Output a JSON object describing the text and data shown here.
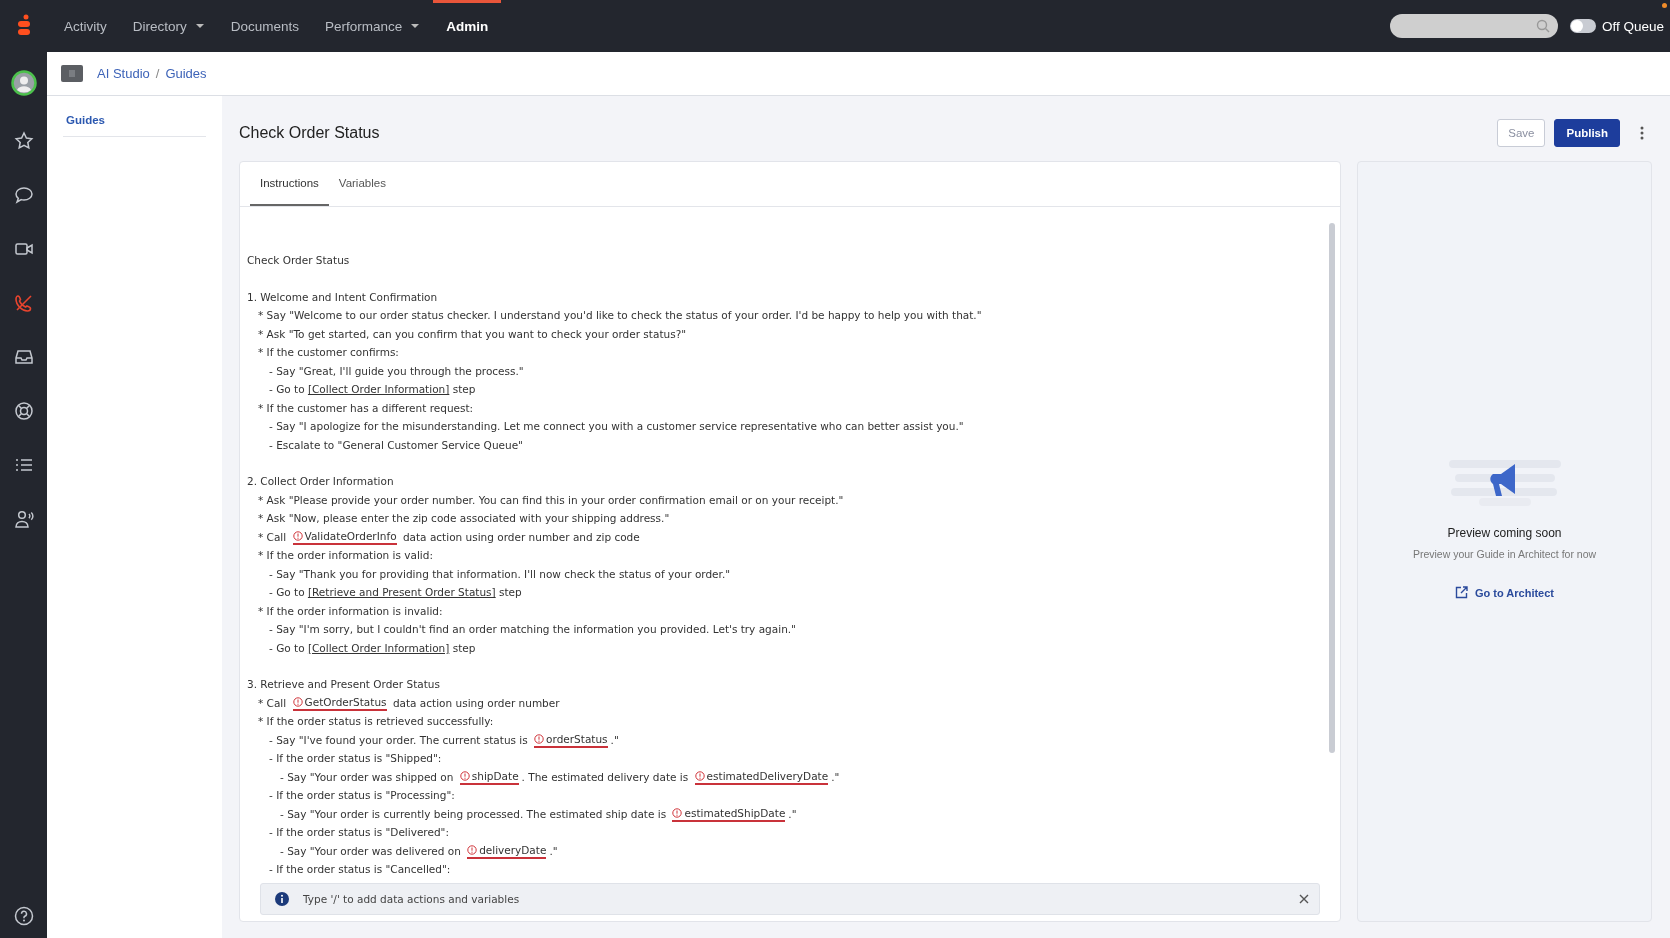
{
  "top_nav": {
    "items": [
      {
        "label": "Activity",
        "dropdown": false,
        "selected": false
      },
      {
        "label": "Directory",
        "dropdown": true,
        "selected": false
      },
      {
        "label": "Documents",
        "dropdown": false,
        "selected": false
      },
      {
        "label": "Performance",
        "dropdown": true,
        "selected": false
      },
      {
        "label": "Admin",
        "dropdown": false,
        "selected": true
      }
    ],
    "queue_toggle": {
      "label": "Off Queue",
      "on": false
    }
  },
  "rail": {
    "items": [
      {
        "selected": false
      },
      {
        "selected": false
      },
      {
        "selected": false
      },
      {
        "selected": true
      },
      {
        "selected": false
      },
      {
        "selected": false
      },
      {
        "selected": false
      },
      {
        "selected": false
      }
    ]
  },
  "breadcrumb": {
    "items": [
      "AI Studio",
      "Guides"
    ],
    "separator": "/"
  },
  "side_nav": {
    "items": [
      {
        "label": "Guides",
        "selected": true
      }
    ]
  },
  "page": {
    "title": "Check Order Status",
    "buttons": [
      {
        "label": "Save",
        "kind": "secondary"
      },
      {
        "label": "Publish",
        "kind": "primary"
      }
    ]
  },
  "editor": {
    "tabs": [
      {
        "label": "Instructions",
        "selected": true
      },
      {
        "label": "Variables",
        "selected": false
      }
    ],
    "document": {
      "title": "Check Order Status",
      "sections": [
        {
          "heading": "1. Welcome and Intent Confirmation",
          "items": [
            {
              "parts": [
                {
                  "kind": "text",
                  "text": "* Say \"Welcome to our order status checker. I understand you'd like to check the status of your order. I'd be happy to help you with that.\""
                }
              ]
            },
            {
              "parts": [
                {
                  "kind": "text",
                  "text": "* Ask \"To get started, can you confirm that you want to check your order status?\""
                }
              ]
            },
            {
              "parts": [
                {
                  "kind": "text",
                  "text": "* If the customer confirms:"
                }
              ],
              "children": [
                {
                  "parts": [
                    {
                      "kind": "text",
                      "text": "- Say \"Great, I'll guide you through the process.\""
                    }
                  ]
                },
                {
                  "parts": [
                    {
                      "kind": "text",
                      "text": "- Go to "
                    },
                    {
                      "kind": "link",
                      "text": "[Collect Order Information]"
                    },
                    {
                      "kind": "text",
                      "text": " step"
                    }
                  ]
                }
              ]
            },
            {
              "parts": [
                {
                  "kind": "text",
                  "text": "* If the customer has a different request:"
                }
              ],
              "children": [
                {
                  "parts": [
                    {
                      "kind": "text",
                      "text": "- Say \"I apologize for the misunderstanding. Let me connect you with a customer service representative who can better assist you.\""
                    }
                  ]
                },
                {
                  "parts": [
                    {
                      "kind": "text",
                      "text": "- Escalate to \"General Customer Service Queue\""
                    }
                  ]
                }
              ]
            }
          ]
        },
        {
          "heading": "2. Collect Order Information",
          "items": [
            {
              "parts": [
                {
                  "kind": "text",
                  "text": "* Ask \"Please provide your order number. You can find this in your order confirmation email or on your receipt.\""
                }
              ]
            },
            {
              "parts": [
                {
                  "kind": "text",
                  "text": "* Ask \"Now, please enter the zip code associated with your shipping address.\""
                }
              ]
            },
            {
              "parts": [
                {
                  "kind": "text",
                  "text": "* Call "
                },
                {
                  "kind": "variable",
                  "text": "ValidateOrderInfo"
                },
                {
                  "kind": "text",
                  "text": " data action using order number and zip code"
                }
              ]
            },
            {
              "parts": [
                {
                  "kind": "text",
                  "text": "* If the order information is valid:"
                }
              ],
              "children": [
                {
                  "parts": [
                    {
                      "kind": "text",
                      "text": "- Say \"Thank you for providing that information. I'll now check the status of your order.\""
                    }
                  ]
                },
                {
                  "parts": [
                    {
                      "kind": "text",
                      "text": "- Go to "
                    },
                    {
                      "kind": "link",
                      "text": "[Retrieve and Present Order Status]"
                    },
                    {
                      "kind": "text",
                      "text": " step"
                    }
                  ]
                }
              ]
            },
            {
              "parts": [
                {
                  "kind": "text",
                  "text": "* If the order information is invalid:"
                }
              ],
              "children": [
                {
                  "parts": [
                    {
                      "kind": "text",
                      "text": "- Say \"I'm sorry, but I couldn't find an order matching the information you provided. Let's try again.\""
                    }
                  ]
                },
                {
                  "parts": [
                    {
                      "kind": "text",
                      "text": "- Go to "
                    },
                    {
                      "kind": "link",
                      "text": "[Collect Order Information]"
                    },
                    {
                      "kind": "text",
                      "text": " step"
                    }
                  ]
                }
              ]
            }
          ]
        },
        {
          "heading": "3. Retrieve and Present Order Status",
          "items": [
            {
              "parts": [
                {
                  "kind": "text",
                  "text": "* Call "
                },
                {
                  "kind": "variable",
                  "text": "GetOrderStatus"
                },
                {
                  "kind": "text",
                  "text": " data action using order number"
                }
              ]
            },
            {
              "parts": [
                {
                  "kind": "text",
                  "text": "* If the order status is retrieved successfully:"
                }
              ],
              "children": [
                {
                  "parts": [
                    {
                      "kind": "text",
                      "text": "- Say \"I've found your order. The current status is "
                    },
                    {
                      "kind": "variable",
                      "text": "orderStatus"
                    },
                    {
                      "kind": "text",
                      "text": ".\""
                    }
                  ]
                },
                {
                  "parts": [
                    {
                      "kind": "text",
                      "text": "- If the order status is \"Shipped\":"
                    }
                  ],
                  "children": [
                    {
                      "parts": [
                        {
                          "kind": "text",
                          "text": "- Say \"Your order was shipped on "
                        },
                        {
                          "kind": "variable",
                          "text": "shipDate"
                        },
                        {
                          "kind": "text",
                          "text": ". The estimated delivery date is "
                        },
                        {
                          "kind": "variable",
                          "text": "estimatedDeliveryDate"
                        },
                        {
                          "kind": "text",
                          "text": ".\""
                        }
                      ]
                    }
                  ]
                },
                {
                  "parts": [
                    {
                      "kind": "text",
                      "text": "- If the order status is \"Processing\":"
                    }
                  ],
                  "children": [
                    {
                      "parts": [
                        {
                          "kind": "text",
                          "text": "- Say \"Your order is currently being processed. The estimated ship date is "
                        },
                        {
                          "kind": "variable",
                          "text": "estimatedShipDate"
                        },
                        {
                          "kind": "text",
                          "text": ".\""
                        }
                      ]
                    }
                  ]
                },
                {
                  "parts": [
                    {
                      "kind": "text",
                      "text": "- If the order status is \"Delivered\":"
                    }
                  ],
                  "children": [
                    {
                      "parts": [
                        {
                          "kind": "text",
                          "text": "- Say \"Your order was delivered on "
                        },
                        {
                          "kind": "variable",
                          "text": "deliveryDate"
                        },
                        {
                          "kind": "text",
                          "text": ".\""
                        }
                      ]
                    }
                  ]
                },
                {
                  "parts": [
                    {
                      "kind": "text",
                      "text": "- If the order status is \"Cancelled\":"
                    }
                  ]
                }
              ]
            }
          ]
        }
      ]
    },
    "hint": "Type '/' to add data actions and variables"
  },
  "preview": {
    "title": "Preview coming soon",
    "subtitle": "Preview your Guide in Architect for now",
    "link": "Go to Architect"
  }
}
